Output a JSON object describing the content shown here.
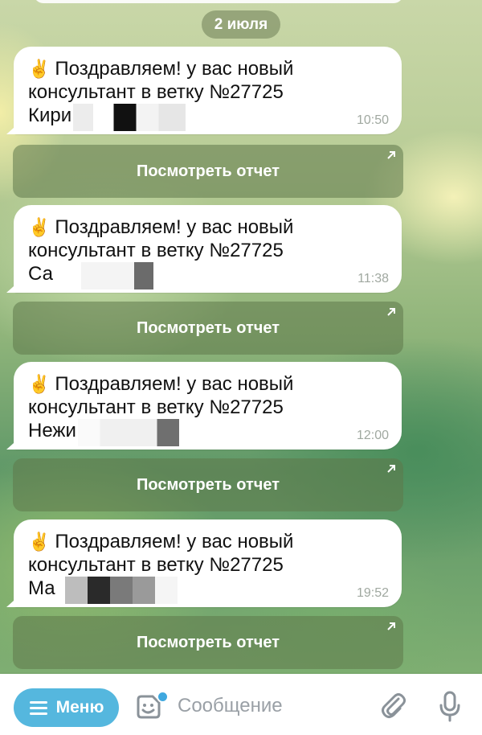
{
  "chat": {
    "date_label": "2 июля",
    "messages": [
      {
        "emoji": "✌️",
        "line1": "Поздравляем! у вас новый",
        "line2": "консультант в ветку №27725",
        "name_visible": "Кири",
        "time": "10:50",
        "button_label": "Посмотреть отчет"
      },
      {
        "emoji": "✌️",
        "line1": "Поздравляем! у вас новый",
        "line2": "консультант в ветку №27725",
        "name_visible": "Са",
        "time": "11:38",
        "button_label": "Посмотреть отчет"
      },
      {
        "emoji": "✌️",
        "line1": "Поздравляем! у вас новый",
        "line2": "консультант в ветку №27725",
        "name_visible": "Нежи",
        "time": "12:00",
        "button_label": "Посмотреть отчет"
      },
      {
        "emoji": "✌️",
        "line1": "Поздравляем! у вас новый",
        "line2": "консультант в ветку №27725",
        "name_visible": "Ма",
        "time": "19:52",
        "button_label": "Посмотреть отчет"
      }
    ]
  },
  "input_bar": {
    "menu_label": "Меню",
    "placeholder": "Сообщение",
    "icons": [
      "menu-icon",
      "sticker-icon",
      "attach-icon",
      "mic-icon"
    ]
  },
  "colors": {
    "menu_button": "#55b7de",
    "bubble": "#ffffff",
    "inline_button": "#5f784b"
  }
}
